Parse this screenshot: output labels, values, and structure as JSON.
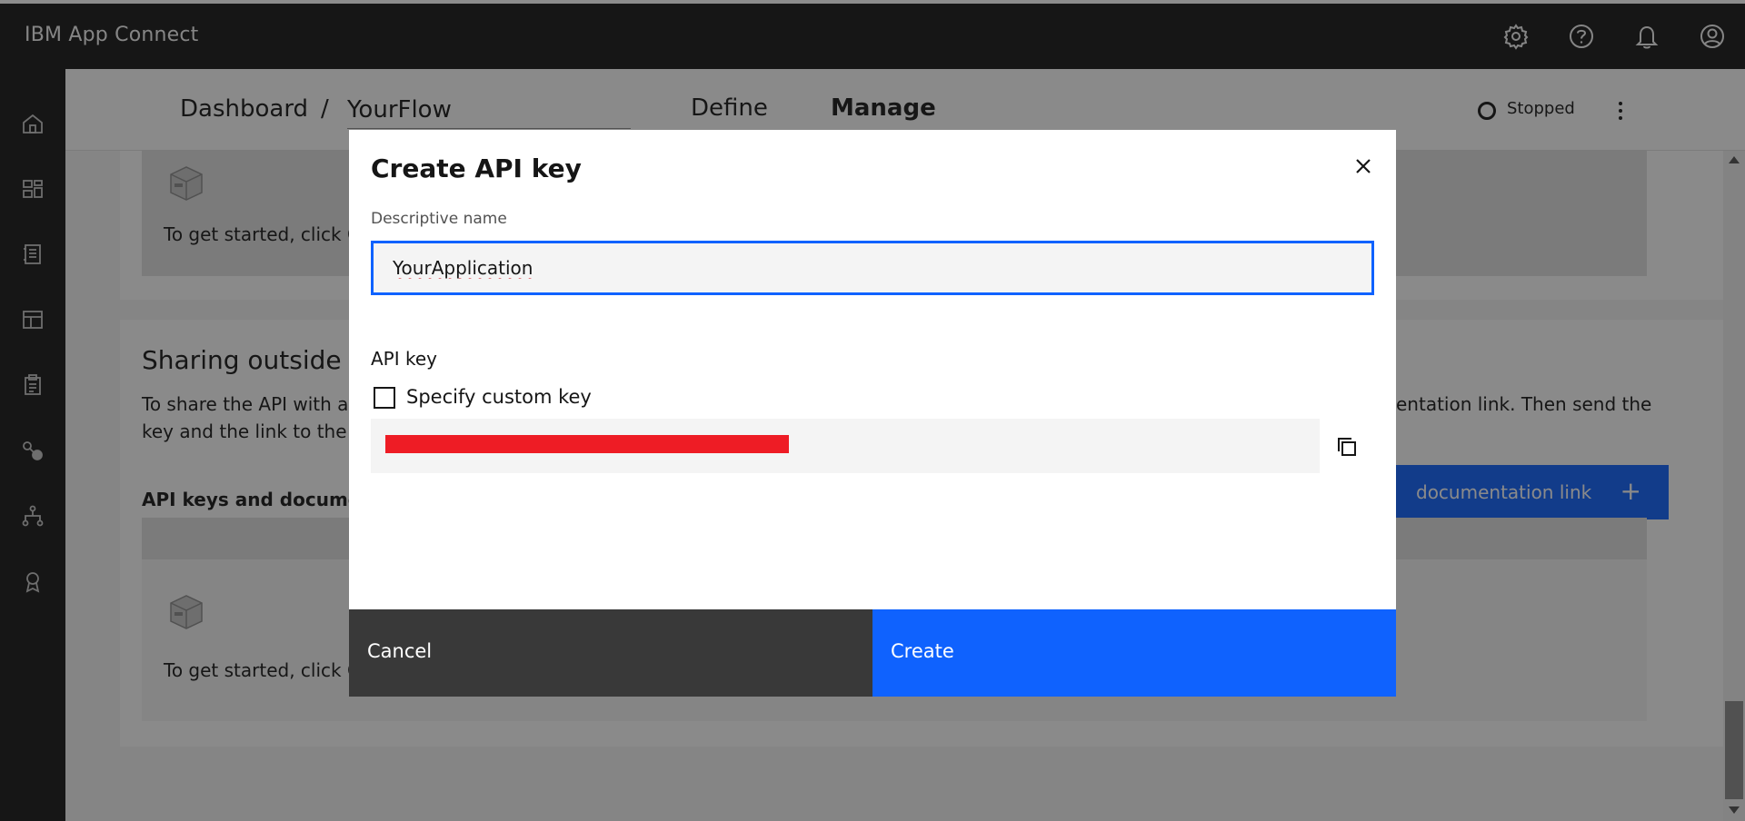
{
  "app": {
    "title": "IBM App Connect"
  },
  "topbar": {
    "icons": [
      "gear-icon",
      "help-icon",
      "notification-icon",
      "user-icon"
    ]
  },
  "sidenav": {
    "icons": [
      "home-icon",
      "dashboard-icon",
      "catalog-icon",
      "templates-icon",
      "clipboard-icon",
      "connections-icon",
      "hierarchy-icon",
      "badge-icon"
    ]
  },
  "header": {
    "breadcrumb_root": "Dashboard",
    "breadcrumb_sep": "/",
    "flow_name": "YourFlow",
    "tab_define": "Define",
    "tab_manage": "Manage",
    "status": "Stopped"
  },
  "background": {
    "empty_text_1": "To get started, click C",
    "sharing_title": "Sharing outside c",
    "sharing_desc_left_1": "To share the API with a",
    "sharing_desc_left_2": "key and the link to the d",
    "sharing_desc_right_1": "entation link. Then send the",
    "keys_subtitle": "API keys and documen",
    "create_link_label": "documentation link",
    "create_link_plus": "+",
    "empty_text_2": "To get started, click C"
  },
  "modal": {
    "title": "Create API key",
    "name_label": "Descriptive name",
    "name_value": "YourApplication",
    "api_key_label": "API key",
    "custom_key_label": "Specify custom key",
    "cancel_label": "Cancel",
    "create_label": "Create"
  },
  "colors": {
    "primary": "#0f62fe",
    "shell": "#161616",
    "redaction": "#ee1c25"
  }
}
